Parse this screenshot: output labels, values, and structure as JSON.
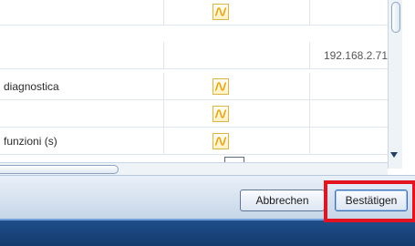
{
  "grid": {
    "rows": [
      {
        "label": "",
        "has_icon": true,
        "value": ""
      },
      {
        "label": "",
        "has_icon": false,
        "value": "192.168.2.71"
      },
      {
        "label": "diagnostica",
        "has_icon": true,
        "value": ""
      },
      {
        "label": "",
        "has_icon": true,
        "value": ""
      },
      {
        "label": "funzioni (s)",
        "has_icon": true,
        "value": ""
      }
    ],
    "icon_name": "waveform-icon",
    "icon_color": "#e8a317"
  },
  "dialog": {
    "cancel_label": "Abbrechen",
    "confirm_label": "Bestätigen",
    "highlight_color": "#e3131f"
  },
  "theme": {
    "footer_band": "#1f4f8c",
    "grid_line": "#dfe6ee"
  }
}
